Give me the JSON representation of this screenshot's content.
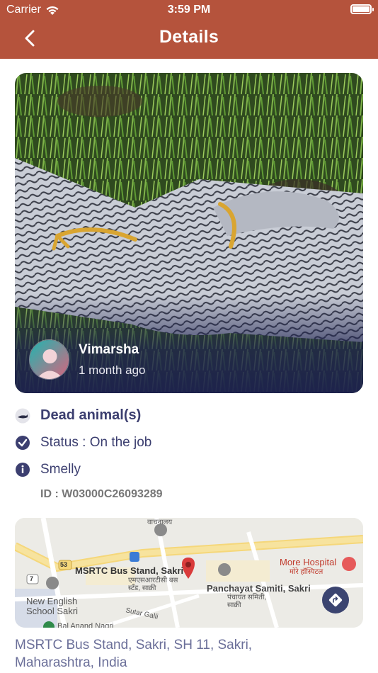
{
  "status_bar": {
    "carrier": "Carrier",
    "time": "3:59 PM"
  },
  "nav": {
    "title": "Details"
  },
  "report": {
    "author": "Vimarsha",
    "posted": "1 month ago",
    "category": "Dead animal(s)",
    "status": "Status : On the job",
    "note": "Smelly",
    "id": "ID : W03000C26093289"
  },
  "map": {
    "labels": {
      "bus_stand": "MSRTC Bus Stand, Sakri",
      "bus_stand_local": "एमएसआरटीसी बस स्टँड, साक्री",
      "panchayat": "Panchayat Samiti, Sakri",
      "panchayat_local": "पंचायत समिती, साक्री",
      "hospital": "More Hospital",
      "hospital_local": "मोरे हॉस्पिटल",
      "school_line1": "New English",
      "school_line2": "School Sakri",
      "street": "Sutar Galli",
      "route_53": "53",
      "route_7": "7",
      "library": "वाचनालय",
      "bottom": "Bal Anand Nagri"
    }
  },
  "address": "MSRTC Bus Stand, Sakri, SH 11, Sakri, Maharashtra, India",
  "colors": {
    "header": "#b5533c",
    "accent": "#3c3f70"
  }
}
